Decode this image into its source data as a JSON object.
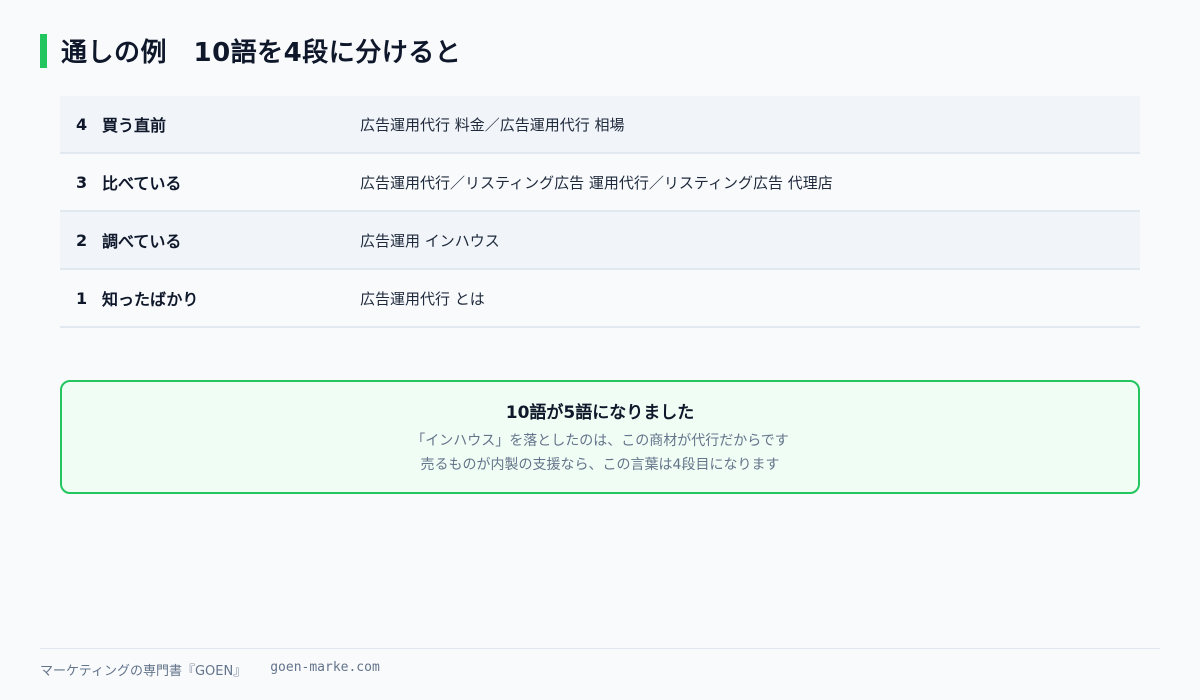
{
  "title": "通しの例　10語を4段に分けると",
  "stages": [
    {
      "number": "4",
      "label": "買う直前",
      "keywords": "広告運用代行 料金／広告運用代行 相場"
    },
    {
      "number": "3",
      "label": "比べている",
      "keywords": "広告運用代行／リスティング広告 運用代行／リスティング広告 代理店"
    },
    {
      "number": "2",
      "label": "調べている",
      "keywords": "広告運用 インハウス"
    },
    {
      "number": "1",
      "label": "知ったばかり",
      "keywords": "広告運用代行 とは"
    }
  ],
  "result": {
    "heading": "10語が5語になりました",
    "line1": "「インハウス」を落としたのは、この商材が代行だからです",
    "line2": "売るものが内製の支援なら、この言葉は4段目になります"
  },
  "footer": {
    "brand": "マーケティングの専門書『GOEN』",
    "url": "goen-marke.com"
  },
  "colors": {
    "accent": "#22c55e",
    "result_bg": "#f0fdf4"
  }
}
